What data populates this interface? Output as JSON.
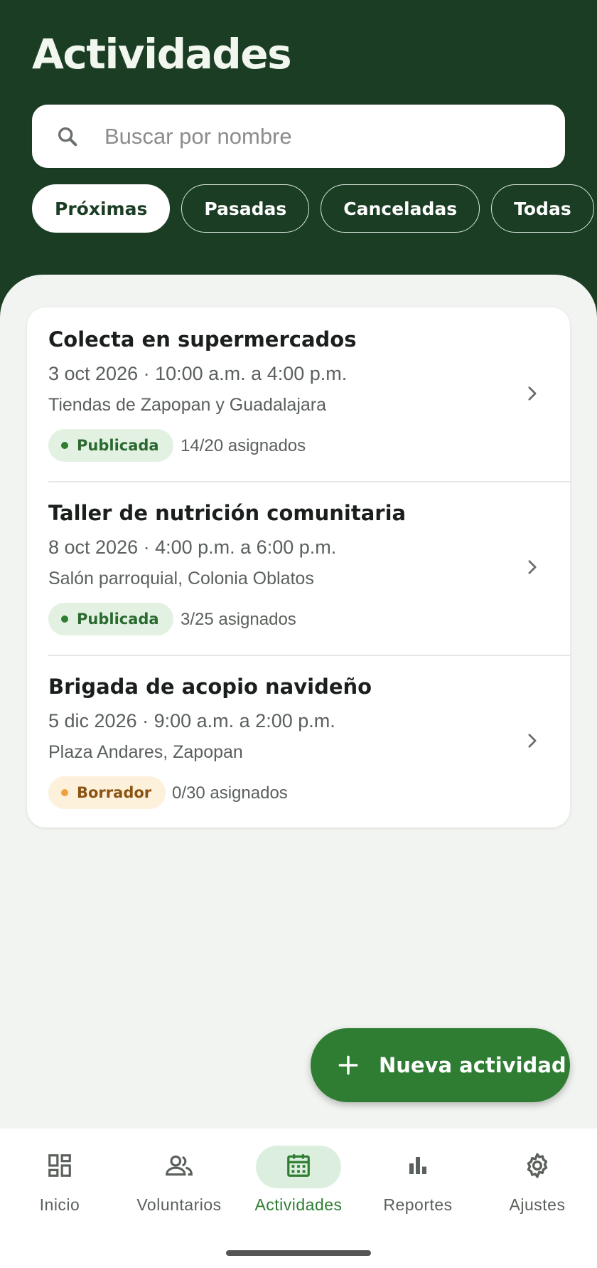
{
  "header": {
    "title": "Actividades",
    "search_placeholder": "Buscar por nombre"
  },
  "filters": [
    {
      "label": "Próximas",
      "active": true
    },
    {
      "label": "Pasadas",
      "active": false
    },
    {
      "label": "Canceladas",
      "active": false
    },
    {
      "label": "Todas",
      "active": false
    }
  ],
  "activities": [
    {
      "title": "Colecta en supermercados",
      "when": "3 oct 2026 · 10:00 a.m. a 4:00 p.m.",
      "where": "Tiendas de Zapopan y Guadalajara",
      "status": "Publicada",
      "assigned": "14/20 asignados"
    },
    {
      "title": "Taller de nutrición comunitaria",
      "when": "8 oct 2026 · 4:00 p.m. a 6:00 p.m.",
      "where": "Salón parroquial, Colonia Oblatos",
      "status": "Publicada",
      "assigned": "3/25 asignados"
    },
    {
      "title": "Brigada de acopio navideño",
      "when": "5 dic 2026 · 9:00 a.m. a 2:00 p.m.",
      "where": "Plaza Andares, Zapopan",
      "status": "Borrador",
      "assigned": "0/30 asignados"
    }
  ],
  "fab": {
    "label": "Nueva actividad",
    "icon": "plus-icon"
  },
  "nav": [
    {
      "label": "Inicio",
      "icon": "dashboard-icon",
      "active": false
    },
    {
      "label": "Voluntarios",
      "icon": "people-icon",
      "active": false
    },
    {
      "label": "Actividades",
      "icon": "calendar-icon",
      "active": true
    },
    {
      "label": "Reportes",
      "icon": "bar-chart-icon",
      "active": false
    },
    {
      "label": "Ajustes",
      "icon": "gear-icon",
      "active": false
    }
  ],
  "colors": {
    "header_bg": "#1b3d24",
    "accent": "#2e7d32",
    "published": "#2e7d32",
    "draft": "#f0a13a"
  }
}
